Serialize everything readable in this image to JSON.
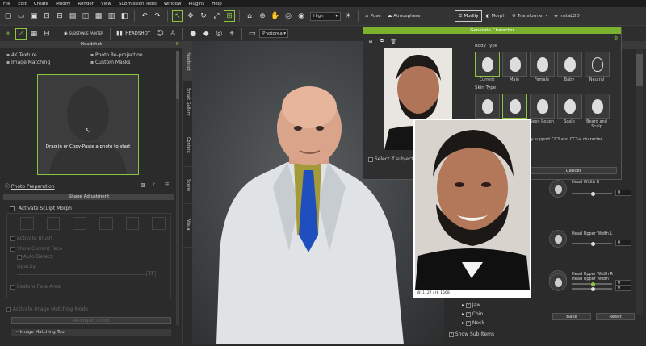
{
  "menu": [
    "File",
    "Edit",
    "Create",
    "Modify",
    "Render",
    "View",
    "Submission Tools",
    "Window",
    "Plugins",
    "Help"
  ],
  "toolbar": {
    "quality": "High",
    "pose": "Pose",
    "atmosphere": "Atmosphere",
    "modify": "Modify",
    "morph": "Morph",
    "transformer": "Transformer",
    "instalod": "InstaLOD"
  },
  "toolbar2": {
    "headshot": "HEADSHOT",
    "substance": "SUBSTANCE PAINTER",
    "render_mode": "Photoreal"
  },
  "left": {
    "title": "Headshot",
    "options": [
      "4K Texture",
      "Photo Re-projection",
      "Image Matching",
      "Custom Masks"
    ],
    "drop_text": "Drag in or Copy-Paste a photo to start",
    "photo_prep": "Photo Preparation",
    "shape_adjustment": "Shape Adjustment",
    "activate_sculpt": "Activate Sculpt Morph",
    "sculpt_opts": [
      "Activate Brush",
      "Show Current Face",
      "Auto Detect",
      "Opacity",
      "Restore Face Area"
    ],
    "opacity_val": "11",
    "activate_matching": "Activate Image Matching Mode",
    "reproject": "Re-Project Photo",
    "image_matching_tool": "Image Matching Tool"
  },
  "vtabs": [
    "Headshot",
    "Smart Gallery",
    "Content",
    "Scene",
    "Visual"
  ],
  "dialog": {
    "title": "Generate Character",
    "body_type_label": "Body Type",
    "body_types": [
      "Current",
      "Male",
      "Female",
      "Baby",
      "Neutral"
    ],
    "skin_type_label": "Skin Type",
    "skin_types": [
      "",
      "",
      "Seen Rough",
      "Scalp",
      "Beard and Scalp"
    ],
    "note": "only support CC3 and CC3+ character",
    "select_subject": "Select if subject is a",
    "cancel": "Cancel",
    "photo_info": "W: 1127 / H: 1568"
  },
  "right": {
    "sliders": [
      {
        "label": "Head Width R",
        "value": "0"
      },
      {
        "label": "Head Upper Width L",
        "value": "0"
      },
      {
        "label": "Head Upper Width R",
        "value": "0"
      },
      {
        "label": "Head Upper Width",
        "value": "0"
      }
    ],
    "tree": [
      "Jaw",
      "Chin",
      "Neck"
    ],
    "show_sub": "Show Sub Items",
    "bake": "Bake",
    "reset": "Reset"
  }
}
